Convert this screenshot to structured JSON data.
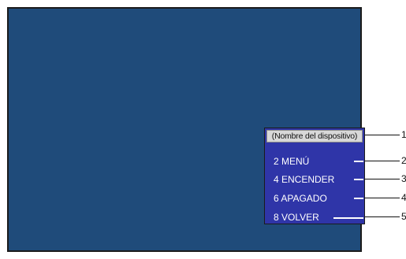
{
  "overlay": {
    "device_name": "(Nombre del dispositivo)",
    "items": [
      {
        "label": "2 MENÚ"
      },
      {
        "label": "4 ENCENDER"
      },
      {
        "label": "6 APAGADO"
      },
      {
        "label": "8 VOLVER"
      }
    ]
  },
  "callouts": [
    "1",
    "2",
    "3",
    "4",
    "5"
  ],
  "colors": {
    "screen_background": "#1f4b7a",
    "menu_background": "#2f35a8",
    "device_name_background": "#d8d8d8",
    "text": "#ffffff"
  }
}
